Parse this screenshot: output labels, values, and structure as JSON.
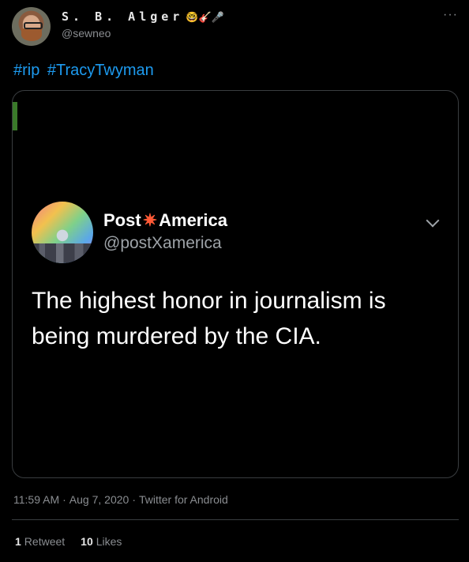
{
  "tweet": {
    "author": {
      "display_name": "S. B. Alger",
      "emojis": [
        "🤓",
        "🎸",
        "🎤"
      ],
      "handle": "@sewneo"
    },
    "more_label": "···",
    "hashtags": [
      "#rip",
      "#TracyTwyman"
    ],
    "media": {
      "embedded_post": {
        "name_left": "Post",
        "name_icon": "✷",
        "name_right": "America",
        "handle": "@postXamerica",
        "text": "The highest honor in journalism is being murdered by the CIA."
      }
    },
    "meta": {
      "time": "11:59 AM",
      "date": "Aug 7, 2020",
      "source": "Twitter for Android",
      "separator": "·"
    },
    "stats": {
      "retweets_count": "1",
      "retweets_label": "Retweet",
      "likes_count": "10",
      "likes_label": "Likes"
    }
  }
}
